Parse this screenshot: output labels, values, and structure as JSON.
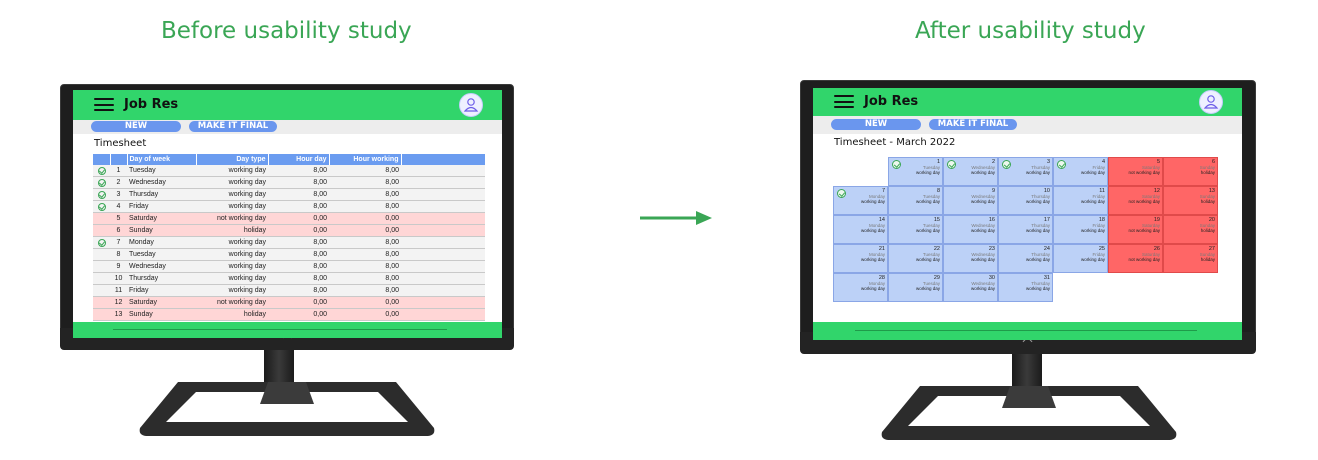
{
  "left_heading": "Before usability study",
  "right_heading": "After usability study",
  "colors": {
    "accent_green": "#3aa655",
    "topbar_green": "#31d56b",
    "pill_blue": "#6a96ee",
    "weekend_red": "#ff6666",
    "weekday_blue": "#bcd1f7"
  },
  "before": {
    "app_title": "Job Res",
    "new_button": "NEW",
    "final_button": "MAKE IT FINAL",
    "timesheet_title": "Timesheet",
    "columns": [
      "Day of week",
      "Day type",
      "Hour day",
      "Hour working"
    ],
    "rows": [
      {
        "checked": true,
        "n": "1",
        "day": "Tuesday",
        "type": "working day",
        "hour_day": "8,00",
        "hour_working": "8,00",
        "off": false
      },
      {
        "checked": true,
        "n": "2",
        "day": "Wednesday",
        "type": "working day",
        "hour_day": "8,00",
        "hour_working": "8,00",
        "off": false
      },
      {
        "checked": true,
        "n": "3",
        "day": "Thursday",
        "type": "working day",
        "hour_day": "8,00",
        "hour_working": "8,00",
        "off": false
      },
      {
        "checked": true,
        "n": "4",
        "day": "Friday",
        "type": "working day",
        "hour_day": "8,00",
        "hour_working": "8,00",
        "off": false
      },
      {
        "checked": false,
        "n": "5",
        "day": "Saturday",
        "type": "not working day",
        "hour_day": "0,00",
        "hour_working": "0,00",
        "off": true
      },
      {
        "checked": false,
        "n": "6",
        "day": "Sunday",
        "type": "holiday",
        "hour_day": "0,00",
        "hour_working": "0,00",
        "off": true
      },
      {
        "checked": true,
        "n": "7",
        "day": "Monday",
        "type": "working day",
        "hour_day": "8,00",
        "hour_working": "8,00",
        "off": false
      },
      {
        "checked": false,
        "n": "8",
        "day": "Tuesday",
        "type": "working day",
        "hour_day": "8,00",
        "hour_working": "8,00",
        "off": false
      },
      {
        "checked": false,
        "n": "9",
        "day": "Wednesday",
        "type": "working day",
        "hour_day": "8,00",
        "hour_working": "8,00",
        "off": false
      },
      {
        "checked": false,
        "n": "10",
        "day": "Thursday",
        "type": "working day",
        "hour_day": "8,00",
        "hour_working": "8,00",
        "off": false
      },
      {
        "checked": false,
        "n": "11",
        "day": "Friday",
        "type": "working day",
        "hour_day": "8,00",
        "hour_working": "8,00",
        "off": false
      },
      {
        "checked": false,
        "n": "12",
        "day": "Saturday",
        "type": "not working day",
        "hour_day": "0,00",
        "hour_working": "0,00",
        "off": true
      },
      {
        "checked": false,
        "n": "13",
        "day": "Sunday",
        "type": "holiday",
        "hour_day": "0,00",
        "hour_working": "0,00",
        "off": true
      }
    ]
  },
  "after": {
    "app_title": "Job Res",
    "new_button": "NEW",
    "final_button": "MAKE IT FINAL",
    "timesheet_title": "Timesheet - March 2022",
    "days": [
      {
        "d": "1",
        "wd": "Tuesday",
        "type": "working day",
        "off": false,
        "checked": true
      },
      {
        "d": "2",
        "wd": "Wednesday",
        "type": "working day",
        "off": false,
        "checked": true
      },
      {
        "d": "3",
        "wd": "Thursday",
        "type": "working day",
        "off": false,
        "checked": true
      },
      {
        "d": "4",
        "wd": "Friday",
        "type": "working day",
        "off": false,
        "checked": true
      },
      {
        "d": "5",
        "wd": "Saturday",
        "type": "not working day",
        "off": true,
        "checked": false
      },
      {
        "d": "6",
        "wd": "Sunday",
        "type": "holiday",
        "off": true,
        "checked": false
      },
      {
        "d": "7",
        "wd": "Monday",
        "type": "working day",
        "off": false,
        "checked": true
      },
      {
        "d": "8",
        "wd": "Tuesday",
        "type": "working day",
        "off": false,
        "checked": false
      },
      {
        "d": "9",
        "wd": "Wednesday",
        "type": "working day",
        "off": false,
        "checked": false
      },
      {
        "d": "10",
        "wd": "Thursday",
        "type": "working day",
        "off": false,
        "checked": false
      },
      {
        "d": "11",
        "wd": "Friday",
        "type": "working day",
        "off": false,
        "checked": false
      },
      {
        "d": "12",
        "wd": "Saturday",
        "type": "not working day",
        "off": true,
        "checked": false
      },
      {
        "d": "13",
        "wd": "Sunday",
        "type": "holiday",
        "off": true,
        "checked": false
      },
      {
        "d": "14",
        "wd": "Monday",
        "type": "working day",
        "off": false,
        "checked": false
      },
      {
        "d": "15",
        "wd": "Tuesday",
        "type": "working day",
        "off": false,
        "checked": false
      },
      {
        "d": "16",
        "wd": "Wednesday",
        "type": "working day",
        "off": false,
        "checked": false
      },
      {
        "d": "17",
        "wd": "Thursday",
        "type": "working day",
        "off": false,
        "checked": false
      },
      {
        "d": "18",
        "wd": "Friday",
        "type": "working day",
        "off": false,
        "checked": false
      },
      {
        "d": "19",
        "wd": "Saturday",
        "type": "not working day",
        "off": true,
        "checked": false
      },
      {
        "d": "20",
        "wd": "Sunday",
        "type": "holiday",
        "off": true,
        "checked": false
      },
      {
        "d": "21",
        "wd": "Monday",
        "type": "working day",
        "off": false,
        "checked": false
      },
      {
        "d": "22",
        "wd": "Tuesday",
        "type": "working day",
        "off": false,
        "checked": false
      },
      {
        "d": "23",
        "wd": "Wednesday",
        "type": "working day",
        "off": false,
        "checked": false
      },
      {
        "d": "24",
        "wd": "Thursday",
        "type": "working day",
        "off": false,
        "checked": false
      },
      {
        "d": "25",
        "wd": "Friday",
        "type": "working day",
        "off": false,
        "checked": false
      },
      {
        "d": "26",
        "wd": "Saturday",
        "type": "not working day",
        "off": true,
        "checked": false
      },
      {
        "d": "27",
        "wd": "Sunday",
        "type": "holiday",
        "off": true,
        "checked": false
      },
      {
        "d": "28",
        "wd": "Monday",
        "type": "working day",
        "off": false,
        "checked": false
      },
      {
        "d": "29",
        "wd": "Tuesday",
        "type": "working day",
        "off": false,
        "checked": false
      },
      {
        "d": "30",
        "wd": "Wednesday",
        "type": "working day",
        "off": false,
        "checked": false
      },
      {
        "d": "31",
        "wd": "Thursday",
        "type": "working day",
        "off": false,
        "checked": false
      }
    ]
  }
}
